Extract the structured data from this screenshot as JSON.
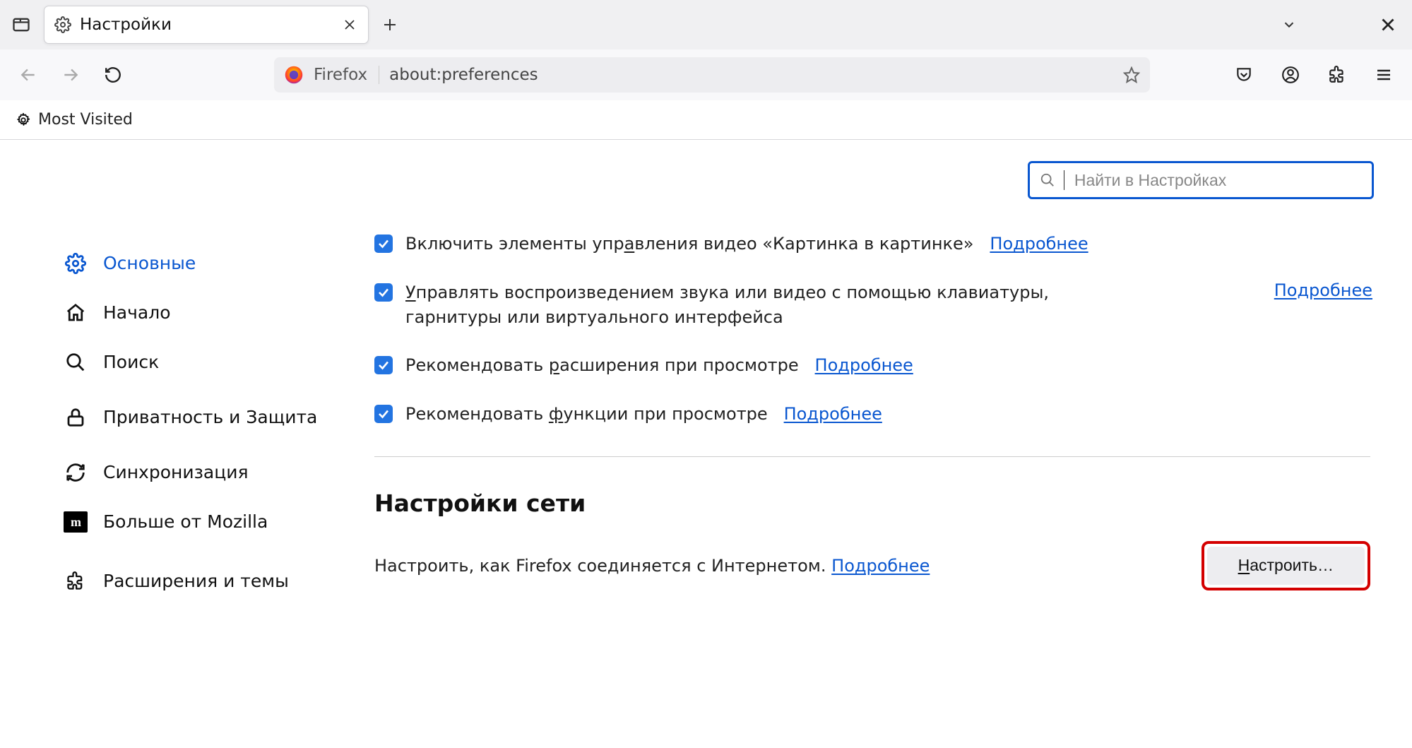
{
  "tab": {
    "title": "Настройки"
  },
  "bookmarks": {
    "most_visited": "Most Visited"
  },
  "toolbar": {
    "identity": "Firefox",
    "url": "about:preferences"
  },
  "search": {
    "placeholder": "Найти в Настройках"
  },
  "sidebar": {
    "general": "Основные",
    "home": "Начало",
    "search": "Поиск",
    "privacy": "Приватность и Защита",
    "sync": "Синхронизация",
    "more": "Больше от Mozilla",
    "extensions": "Расширения и темы"
  },
  "options": {
    "pip_label_pre": "Включить элементы упр",
    "pip_u": "а",
    "pip_label_post": "вления видео «Картинка в картинке»",
    "pip_link": "Подробнее",
    "media_u": "У",
    "media_label": "правлять воспроизведением звука или видео с помощью клавиатуры, гарнитуры или виртуального интерфейса",
    "media_link": "Подробнее",
    "ext_pre": "Рекомендовать ",
    "ext_u": "р",
    "ext_post": "асширения при просмотре",
    "ext_link": "Подробнее",
    "feat_pre": "Рекомендовать ",
    "feat_u": "ф",
    "feat_post": "ункции при просмотре",
    "feat_link": "Подробнее"
  },
  "network": {
    "title": "Настройки сети",
    "desc": "Настроить, как Firefox соединяется с Интернетом.",
    "desc_link": "Подробнее",
    "button_u": "Н",
    "button_rest": "астроить…"
  }
}
